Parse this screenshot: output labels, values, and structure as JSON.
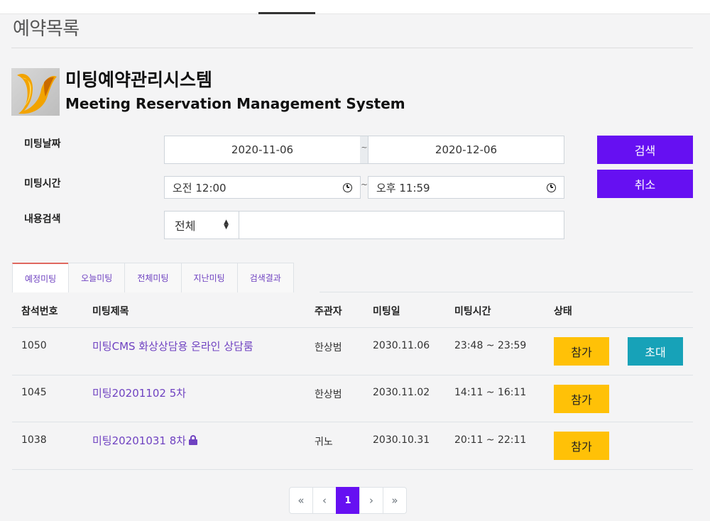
{
  "page": {
    "title": "예약목록"
  },
  "app": {
    "title_ko": "미팅예약관리시스템",
    "title_en": "Meeting Reservation Management System",
    "colors": {
      "primary": "#6610f2",
      "join": "#ffc107",
      "invite": "#17a2b8",
      "link": "#6f42c1"
    }
  },
  "search": {
    "date_label": "미팅날짜",
    "date_from": "2020-11-06",
    "date_to": "2020-12-06",
    "time_label": "미팅시간",
    "time_from": "오전 12:00",
    "time_to": "오후 11:59",
    "content_label": "내용검색",
    "scope_selected": "전체",
    "keyword": "",
    "separator": "~",
    "search_button": "검색",
    "cancel_button": "취소"
  },
  "tabs": [
    {
      "label": "예정미팅",
      "active": true
    },
    {
      "label": "오늘미팅",
      "active": false
    },
    {
      "label": "전체미팅",
      "active": false
    },
    {
      "label": "지난미팅",
      "active": false
    },
    {
      "label": "검색결과",
      "active": false
    }
  ],
  "table": {
    "headers": [
      "참석번호",
      "미팅제목",
      "주관자",
      "미팅일",
      "미팅시간",
      "상태"
    ],
    "rows": [
      {
        "id": "1050",
        "title": "미팅CMS 화상상담용 온라인 상담룸",
        "host": "한상범",
        "date": "2030.11.06",
        "time": "23:48 ~ 23:59",
        "join": "참가",
        "invite": "초대",
        "locked": false
      },
      {
        "id": "1045",
        "title": "미팅20201102 5차",
        "host": "한상범",
        "date": "2030.11.02",
        "time": "14:11 ~ 16:11",
        "join": "참가",
        "locked": false
      },
      {
        "id": "1038",
        "title": "미팅20201031 8차",
        "host": "귀노",
        "date": "2030.10.31",
        "time": "20:11 ~ 22:11",
        "join": "참가",
        "locked": true
      }
    ]
  },
  "pagination": {
    "first": "«",
    "prev": "‹",
    "current": "1",
    "next": "›",
    "last": "»"
  },
  "icons": {
    "clock": "clock-icon",
    "lock": "lock-icon",
    "select_arrows": "select-arrows-icon",
    "logo": "app-logo"
  }
}
